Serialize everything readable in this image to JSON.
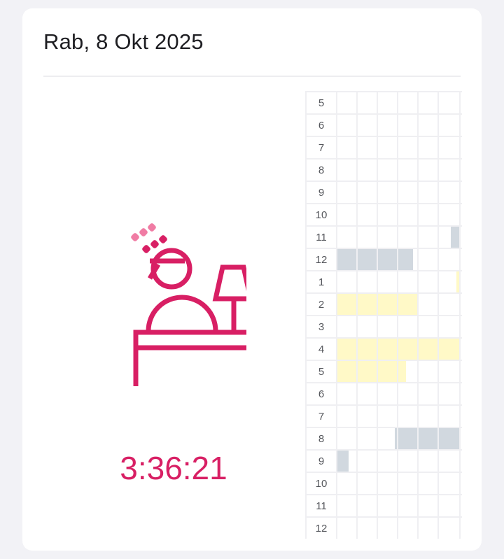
{
  "header": {
    "date": "Rab, 8 Okt 2025"
  },
  "status": {
    "elapsed": "3:36:21",
    "icon": "sleeping-at-desk-icon"
  },
  "colors": {
    "accent": "#d81f64",
    "sleep": "#d1d8df",
    "nap": "#fff9c7"
  },
  "schedule": {
    "hours": [
      "5",
      "6",
      "7",
      "8",
      "9",
      "10",
      "11",
      "12",
      "1",
      "2",
      "3",
      "4",
      "5",
      "6",
      "7",
      "8",
      "9",
      "10",
      "11",
      "12"
    ]
  }
}
